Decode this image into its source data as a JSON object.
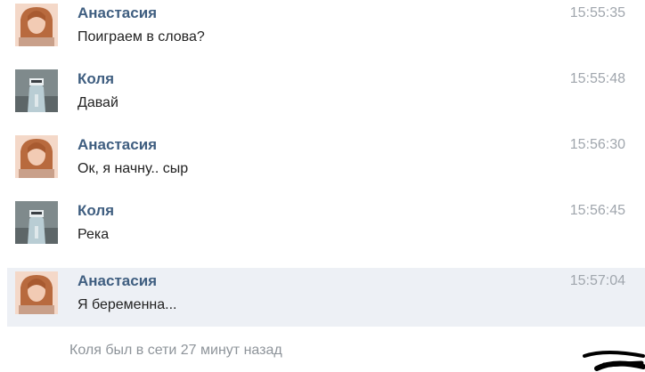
{
  "messages": [
    {
      "sender": "Анастасия",
      "text": "Поиграем в слова?",
      "time": "15:55:35",
      "avatar": "avatar-anastasia"
    },
    {
      "sender": "Коля",
      "text": "Давай",
      "time": "15:55:48",
      "avatar": "avatar-kolya"
    },
    {
      "sender": "Анастасия",
      "text": "Ок, я начну.. сыр",
      "time": "15:56:30",
      "avatar": "avatar-anastasia"
    },
    {
      "sender": "Коля",
      "text": "Река",
      "time": "15:56:45",
      "avatar": "avatar-kolya"
    },
    {
      "sender": "Анастасия",
      "text": "Я беременна...",
      "time": "15:57:04",
      "avatar": "avatar-anastasia"
    }
  ],
  "status_text": "Коля был в сети 27 минут назад",
  "colors": {
    "name": "#3f5e80",
    "time": "#a0a6ad",
    "highlight": "#edf0f5",
    "status": "#8e949a"
  }
}
